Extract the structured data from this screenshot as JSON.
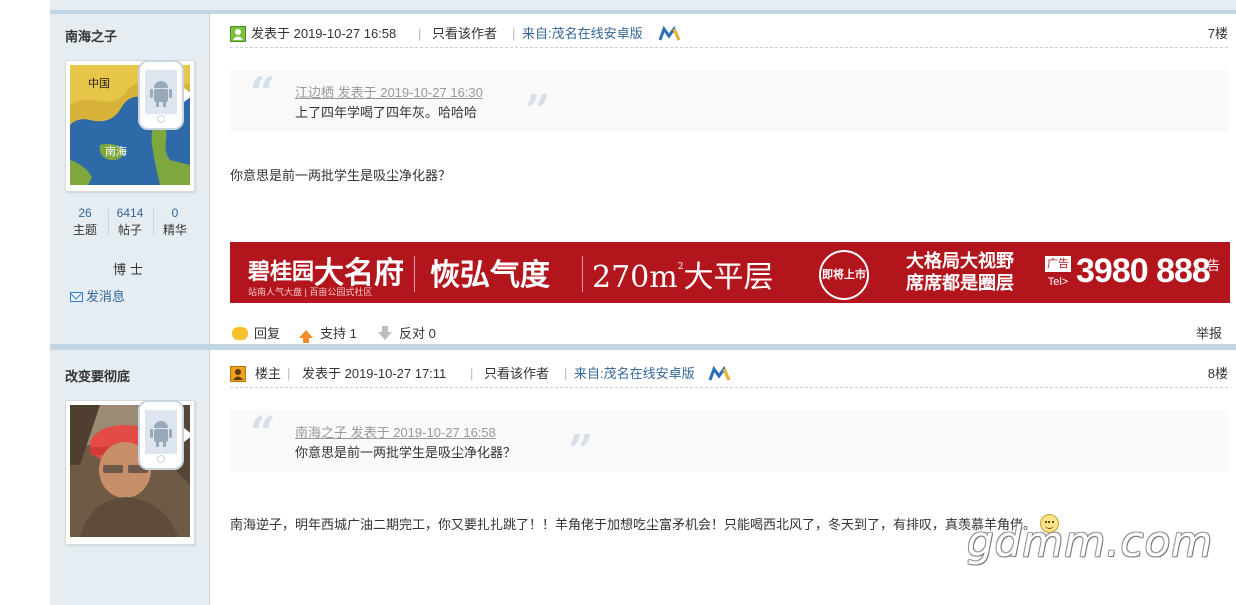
{
  "posts": [
    {
      "author": "南海之子",
      "stats": [
        {
          "value": "26",
          "label": "主题"
        },
        {
          "value": "6414",
          "label": "帖子"
        },
        {
          "value": "0",
          "label": "精华"
        }
      ],
      "rank": "博士",
      "send_message": "发消息",
      "posted": "发表于 2019-10-27 16:58",
      "only_author": "只看该作者",
      "source": "来自:茂名在线安卓版",
      "floor": "7楼",
      "quote": {
        "author_line": "江边栖 发表于 2019-10-27 16:30",
        "text": "上了四年学喝了四年灰。哈哈哈"
      },
      "body": "你意思是前一两批学生是吸尘净化器？",
      "actions": {
        "reply": "回复",
        "support": "支持",
        "support_count": "1",
        "oppose": "反对",
        "oppose_count": "0",
        "report": "举报"
      }
    },
    {
      "author": "改变要彻底",
      "owner_badge": "楼主",
      "posted": "发表于 2019-10-27 17:11",
      "only_author": "只看该作者",
      "source": "来自:茂名在线安卓版",
      "floor": "8楼",
      "quote": {
        "author_line": "南海之子 发表于 2019-10-27 16:58",
        "text": "你意思是前一两批学生是吸尘净化器？"
      },
      "body": "南海逆子，明年西城广油二期完工，你又要扎扎跳了！！羊角佬于加想吃尘富矛机会！只能喝西北风了，冬天到了，有排叹，真羡慕羊角佬。"
    }
  ],
  "ad": {
    "brand": "碧桂园",
    "brand_sub": "站南人气大盘 | 百亩公园式社区",
    "project": "大名府",
    "slogan": "恢弘气度",
    "area": "270m",
    "area_sup": "2",
    "layout": "大平层",
    "seal": "即将上市",
    "tagline_1": "大格局大视野",
    "tagline_2": "席席都是圈层",
    "tel_tag": "广告",
    "tel_prefix": "Tel>",
    "tel": "3980 888",
    "ad_label": "广告"
  },
  "watermark": "gdmm.com",
  "colors": {
    "sidebar_bg": "#e5edf2",
    "border": "#c2d5e3",
    "link": "#336699",
    "ad_red": "#b3151c"
  }
}
